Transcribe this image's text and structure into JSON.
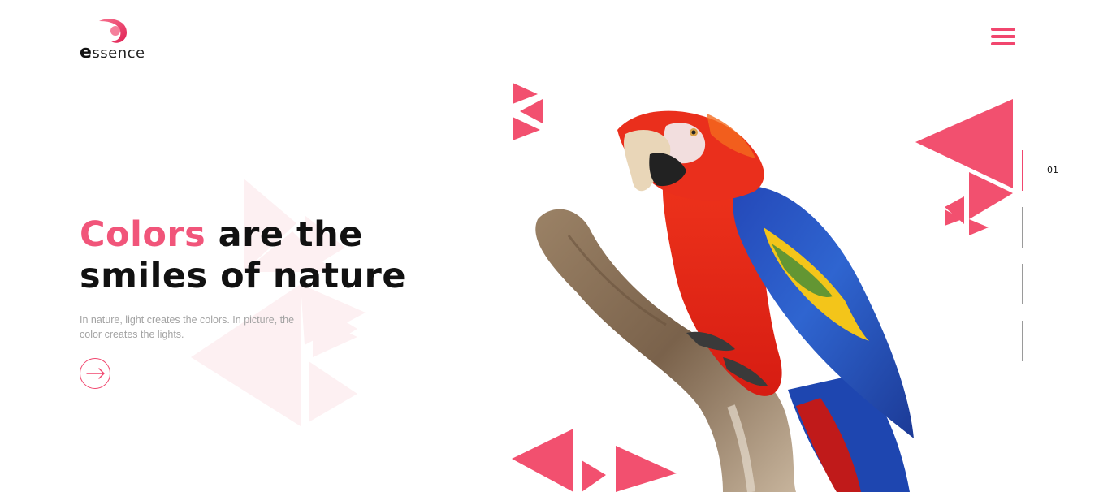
{
  "brand": {
    "name_first_letter": "e",
    "name_rest": "ssence",
    "accent_color": "#f1466e"
  },
  "header": {
    "menu_icon": "hamburger-menu-icon"
  },
  "hero": {
    "headline_accent": "Colors",
    "headline_rest": " are the smiles of nature",
    "subtext": "In nature, light creates the colors. In picture, the color creates the lights.",
    "cta_icon": "arrow-right-icon"
  },
  "slider": {
    "current": "01",
    "total_slides": 4,
    "active_index": 0
  }
}
